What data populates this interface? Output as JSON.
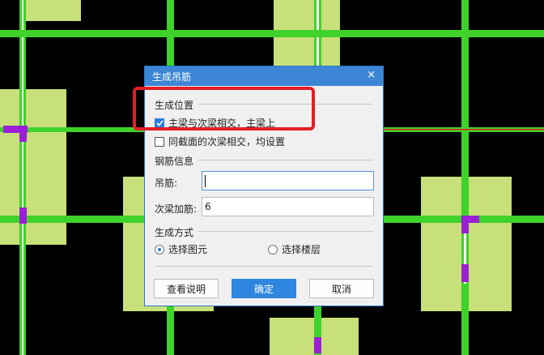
{
  "dialog": {
    "title": "生成吊筋",
    "close_glyph": "×",
    "position_group": {
      "title": "生成位置",
      "option_main": {
        "label": "主梁与次梁相交，主梁上",
        "checked": true
      },
      "option_same_section": {
        "label": "同截面的次梁相交，均设置",
        "checked": false
      }
    },
    "rebar_group": {
      "title": "钢筋信息",
      "hanger_label": "吊筋:",
      "hanger_value": "",
      "secondary_label": "次梁加筋:",
      "secondary_value": "6"
    },
    "method_group": {
      "title": "生成方式",
      "option_select_element": {
        "label": "选择图元",
        "selected": true
      },
      "option_select_floor": {
        "label": "选择楼层",
        "selected": false
      }
    },
    "buttons": {
      "help": "查看说明",
      "ok": "确定",
      "cancel": "取消"
    }
  },
  "colors": {
    "cad_background": "#000000",
    "beam_green": "#3fd22a",
    "column_fill": "#c8e07a",
    "magenta_marker": "#9a1fd6",
    "highlight_red": "#e31e24",
    "accent_blue": "#2f86e0"
  }
}
